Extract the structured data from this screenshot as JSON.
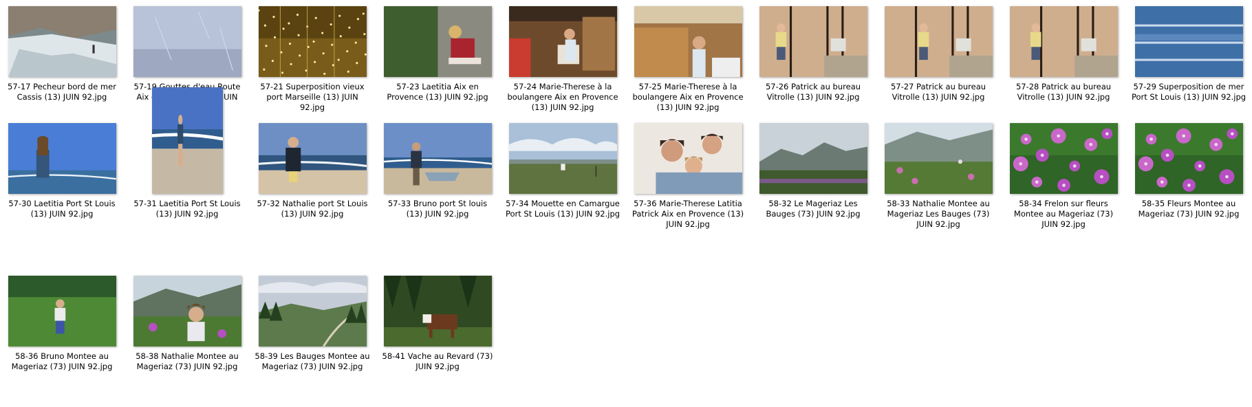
{
  "files": [
    {
      "name": "57-17 Pecheur bord de mer Cassis (13) JUIN 92.jpg",
      "scene": "sea-rocks"
    },
    {
      "name": "57-19 Gouttes d'eau Route Aix en Provence (13) JUIN 92.jpg",
      "scene": "rain-glass"
    },
    {
      "name": "57-21 Superposition vieux port Marseille (13) JUIN 92.jpg",
      "scene": "night-port"
    },
    {
      "name": "57-23 Laetitia Aix en Provence (13) JUIN 92.jpg",
      "scene": "girl-garden"
    },
    {
      "name": "57-24 Marie-Therese à la boulangere Aix en Provence (13) JUIN 92.jpg",
      "scene": "bakery"
    },
    {
      "name": "57-25 Marie-Therese à la boulangere Aix en Provence (13) JUIN 92.jpg",
      "scene": "bakery2"
    },
    {
      "name": "57-26 Patrick au bureau Vitrolle (13) JUIN 92.jpg",
      "scene": "office"
    },
    {
      "name": "57-27 Patrick au bureau Vitrolle (13) JUIN 92.jpg",
      "scene": "office2"
    },
    {
      "name": "57-28 Patrick au bureau Vitrolle (13) JUIN 92.jpg",
      "scene": "office3"
    },
    {
      "name": "57-29 Superposition de mer Port St Louis (13) JUIN 92.jpg",
      "scene": "sea-blue"
    },
    {
      "name": "57-30 Laetitia Port St Louis (13) JUIN 92.jpg",
      "scene": "beach-girl"
    },
    {
      "name": "57-31 Laetitia Port St Louis (13) JUIN 92.jpg",
      "scene": "beach-portrait"
    },
    {
      "name": "57-32 Nathalie port St Louis (13) JUIN 92.jpg",
      "scene": "beach-woman"
    },
    {
      "name": "57-33 Bruno port St louis (13) JUIN 92.jpg",
      "scene": "beach-boat"
    },
    {
      "name": "57-34 Mouette en Camargue Port St Louis (13) JUIN 92.jpg",
      "scene": "camargue"
    },
    {
      "name": "57-36 Marie-Therese Latitia Patrick Aix en Provence (13) JUIN 92.jpg",
      "scene": "family"
    },
    {
      "name": "58-32 Le Mageriaz Les Bauges (73) JUIN 92.jpg",
      "scene": "mountain"
    },
    {
      "name": "58-33 Nathalie Montee au Mageriaz Les Bauges (73) JUIN 92.jpg",
      "scene": "mountain-flowers"
    },
    {
      "name": "58-34 Frelon sur fleurs Montee au Mageriaz (73) JUIN 92.jpg",
      "scene": "pink-flowers"
    },
    {
      "name": "58-35 Fleurs Montee au Mageriaz (73) JUIN 92.jpg",
      "scene": "pink-flowers2"
    },
    {
      "name": "58-36 Bruno Montee au Mageriaz (73) JUIN 92.jpg",
      "scene": "meadow-boy"
    },
    {
      "name": "58-38 Nathalie Montee au Mageriaz (73) JUIN 92.jpg",
      "scene": "meadow-woman"
    },
    {
      "name": "58-39 Les Bauges Montee au Mageriaz (73) JUIN 92.jpg",
      "scene": "forest-valley"
    },
    {
      "name": "58-41 Vache au Revard (73) JUIN 92.jpg",
      "scene": "cow"
    }
  ]
}
